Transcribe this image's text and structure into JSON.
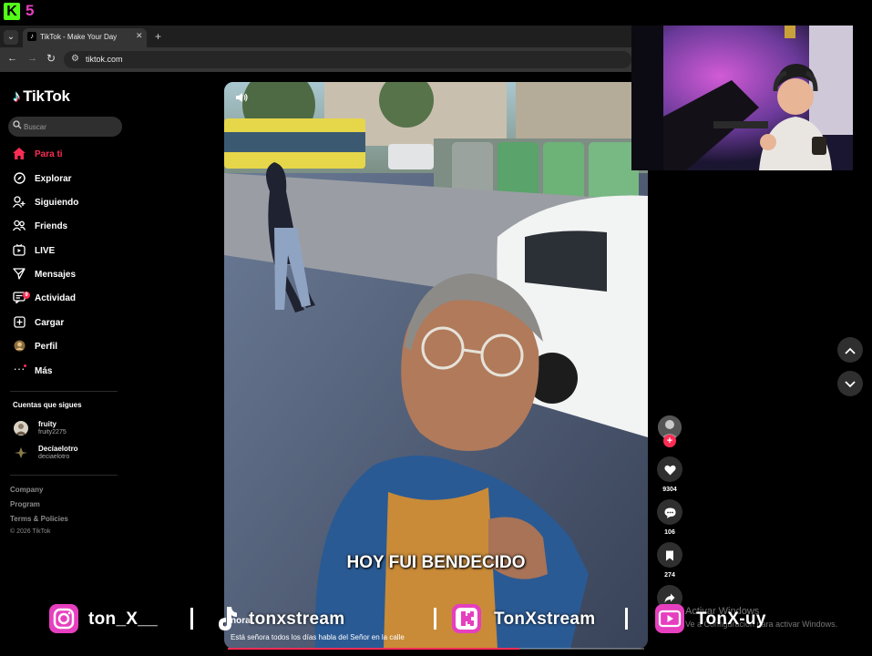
{
  "stream_bar": {
    "logo_letter": "K",
    "count": "5"
  },
  "browser": {
    "tab_title": "TikTok - Make Your Day",
    "tab_close": "✕",
    "new_tab": "+",
    "url": "tiktok.com"
  },
  "sidebar": {
    "brand": "TikTok",
    "search_placeholder": "Buscar",
    "nav": [
      {
        "label": "Para ti",
        "icon": "home-icon",
        "active": true
      },
      {
        "label": "Explorar",
        "icon": "compass-icon"
      },
      {
        "label": "Siguiendo",
        "icon": "following-icon"
      },
      {
        "label": "Friends",
        "icon": "friends-icon"
      },
      {
        "label": "LIVE",
        "icon": "live-icon"
      },
      {
        "label": "Mensajes",
        "icon": "messages-icon"
      },
      {
        "label": "Actividad",
        "icon": "activity-icon",
        "badge": "9"
      },
      {
        "label": "Cargar",
        "icon": "upload-icon"
      },
      {
        "label": "Perfil",
        "icon": "profile-icon"
      },
      {
        "label": "Más",
        "icon": "more-icon"
      }
    ],
    "following_title": "Cuentas que sigues",
    "accounts": [
      {
        "name": "fruity",
        "handle": "fruity2275"
      },
      {
        "name": "Decíaelotro",
        "handle": "deciaelotro"
      }
    ],
    "footer": [
      "Company",
      "Program",
      "Terms & Policies"
    ],
    "copyright": "© 2026 TikTok"
  },
  "video": {
    "caption": "HOY FUI BENDECIDO",
    "author": "nora",
    "description": "Está señora todos los días habla del Señor en la calle",
    "progress": 0.7
  },
  "actions": {
    "likes": "9304",
    "comments": "106",
    "saves": "274"
  },
  "windows_notice": {
    "title": "Activar Windows",
    "subtitle": "Ve a Configuración para activar Windows."
  },
  "socials": [
    {
      "platform": "instagram",
      "label": "ton_X__"
    },
    {
      "platform": "tiktok",
      "label": "tonxstream"
    },
    {
      "platform": "kick",
      "label": "TonXstream"
    },
    {
      "platform": "youtube",
      "label": "TonX-uy"
    }
  ],
  "colors": {
    "accent": "#fe2c55",
    "kick": "#53fc18",
    "social_pink": "#e63fbf"
  }
}
